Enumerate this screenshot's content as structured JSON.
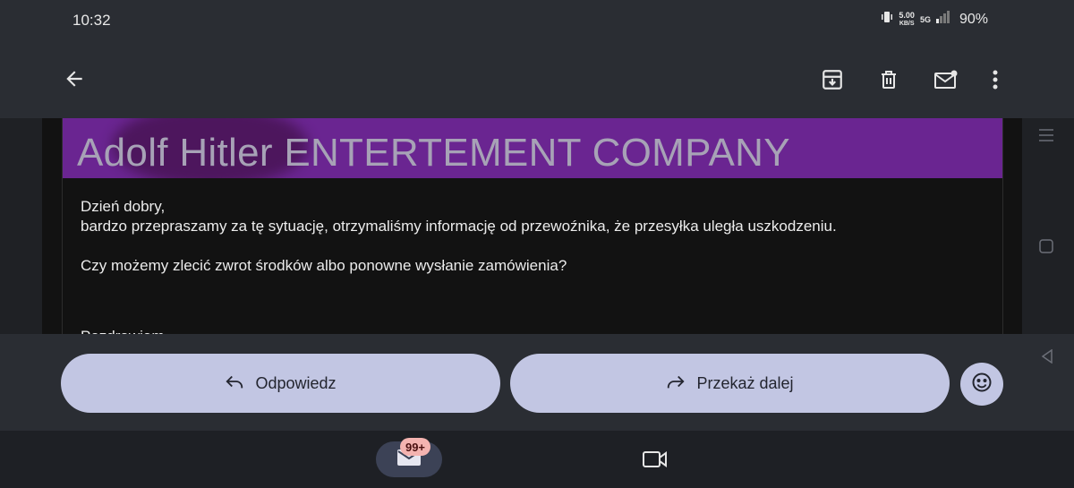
{
  "status_bar": {
    "time": "10:32",
    "net_speed_value": "5.00",
    "net_speed_unit": "KB/S",
    "network": "5G",
    "battery": "90%"
  },
  "app_bar": {
    "icons": [
      "back-arrow-icon",
      "archive-icon",
      "delete-icon",
      "mark-unread-icon",
      "more-vert-icon"
    ]
  },
  "email": {
    "banner_name": "Adolf Hitler",
    "banner_company": "ENTERTEMENT COMPANY",
    "greeting": "Dzień dobry,",
    "line1": "bardzo przepraszamy za tę sytuację, otrzymaliśmy informację od przewoźnika, że przesyłka uległa uszkodzeniu.",
    "line2": "Czy możemy zlecić zwrot środków albo ponowne wysłanie zamówienia?",
    "signoff": "Pozdrawiam"
  },
  "actions": {
    "reply_label": "Odpowiedz",
    "forward_label": "Przekaż dalej"
  },
  "bottom_nav": {
    "mail_badge": "99+"
  },
  "colors": {
    "banner": "#6a2591",
    "pill": "#c2c6e3",
    "badge": "#f4b3b0"
  }
}
